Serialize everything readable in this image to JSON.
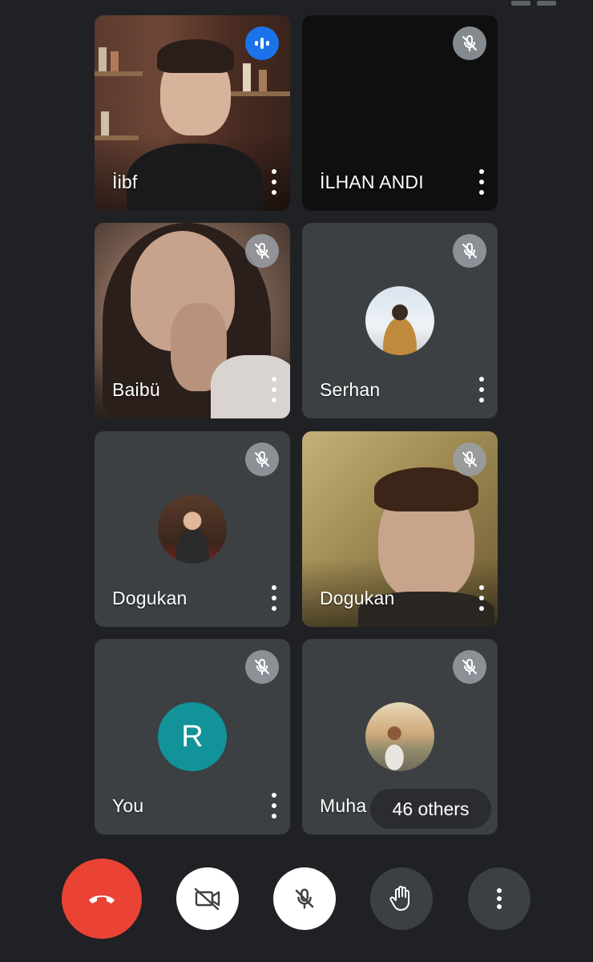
{
  "app": {
    "others_count_label": "46 others"
  },
  "tiles": [
    {
      "name": "İibf",
      "status": "speaking",
      "media": "video"
    },
    {
      "name": "İLHAN ANDI",
      "status": "muted",
      "media": "video-off"
    },
    {
      "name": "Baibü",
      "status": "muted",
      "media": "video"
    },
    {
      "name": "Serhan",
      "status": "muted",
      "media": "avatar-photo"
    },
    {
      "name": "Dogukan",
      "status": "muted",
      "media": "avatar-photo"
    },
    {
      "name": "Dogukan",
      "status": "muted",
      "media": "video"
    },
    {
      "name": "You",
      "status": "muted",
      "media": "avatar-letter",
      "avatar_letter": "R"
    },
    {
      "name": "Muha",
      "status": "muted",
      "media": "avatar-photo"
    }
  ],
  "controls": [
    {
      "id": "end-call",
      "icon": "phone-hangup-icon"
    },
    {
      "id": "camera",
      "icon": "camera-off-icon"
    },
    {
      "id": "mic",
      "icon": "mic-off-icon"
    },
    {
      "id": "raise-hand",
      "icon": "hand-icon"
    },
    {
      "id": "more",
      "icon": "more-vert-icon"
    }
  ],
  "colors": {
    "background": "#202124",
    "tile": "#3c4043",
    "end_call": "#ea4335",
    "speaking": "#1a73e8",
    "you_avatar": "#12939a"
  }
}
